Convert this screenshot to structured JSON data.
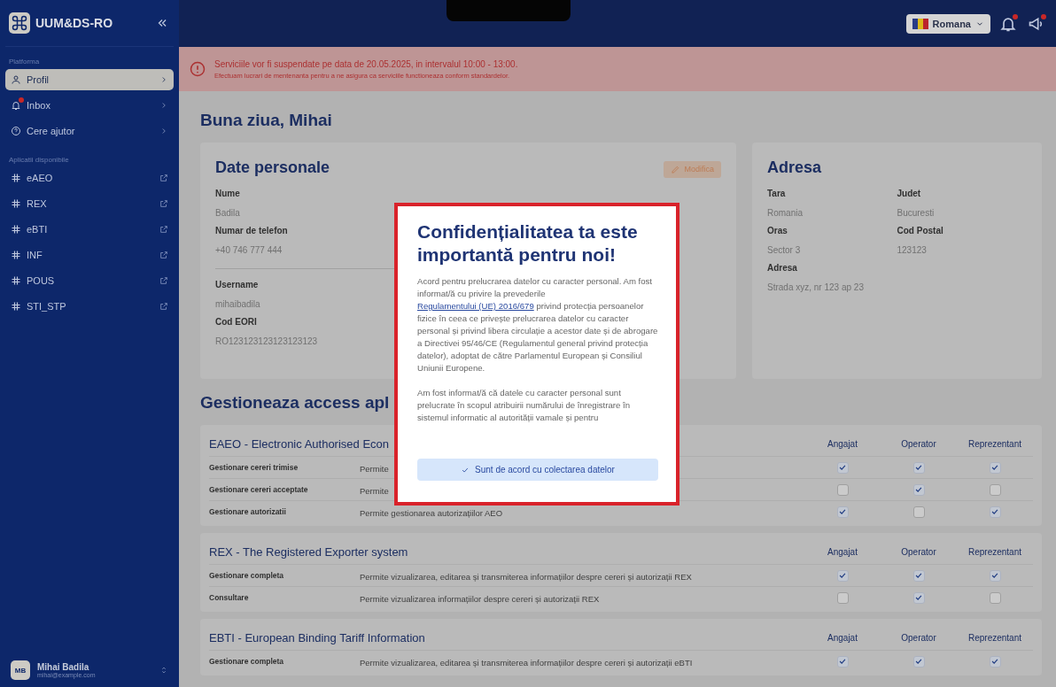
{
  "sidebar": {
    "logo_text": "UUM&DS-RO",
    "sections": [
      {
        "heading": "Platforma",
        "kind": "platform",
        "items": [
          {
            "label": "Profil",
            "selected": true,
            "badge": false
          },
          {
            "label": "Inbox",
            "selected": false,
            "badge": true
          },
          {
            "label": "Cere ajutor",
            "selected": false,
            "badge": false
          }
        ]
      },
      {
        "heading": "Aplicatii disponibile",
        "kind": "apps",
        "items": [
          {
            "label": "eAEO",
            "selected": false,
            "badge": false
          },
          {
            "label": "REX",
            "selected": false,
            "badge": false
          },
          {
            "label": "eBTI",
            "selected": false,
            "badge": false
          },
          {
            "label": "INF",
            "selected": false,
            "badge": false
          },
          {
            "label": "POUS",
            "selected": false,
            "badge": false
          },
          {
            "label": "STI_STP",
            "selected": false,
            "badge": false
          }
        ]
      }
    ],
    "user": {
      "initials": "MB",
      "name": "Mihai Badila",
      "email": "mihai@example.com"
    }
  },
  "header": {
    "language": "Romana",
    "bell_badge": true,
    "megaphone_badge": true
  },
  "alert": {
    "title": "Serviciile vor fi suspendate pe data de 20.05.2025, in intervalul 10:00 - 13:00.",
    "message": "Efectuam lucrari de mentenanta pentru a ne asigura ca serviciile functioneaza conform standardelor."
  },
  "greeting": "Buna ziua, Mihai",
  "personal": {
    "title": "Date personale",
    "edit_button": "Modifica",
    "groups": [
      [
        {
          "label": "Nume",
          "value": "Badila"
        },
        {
          "label": "Numar de telefon",
          "value": "+40 746 777 444"
        }
      ],
      [
        {
          "label": "Username",
          "value": "mihaibadila"
        },
        {
          "label": "Cod EORI",
          "value": "RO123123123123123123"
        }
      ]
    ]
  },
  "address": {
    "title": "Adresa",
    "fields": [
      {
        "label": "Tara",
        "value": "Romania"
      },
      {
        "label": "Judet",
        "value": "Bucuresti"
      },
      {
        "label": "Oras",
        "value": "Sector 3"
      },
      {
        "label": "Cod Postal",
        "value": "123123"
      },
      {
        "label": "Adresa",
        "value": "Strada xyz, nr 123 ap 23"
      }
    ]
  },
  "access": {
    "title": "Gestioneaza access apl",
    "groups": [
      {
        "title": "EAEO - Electronic Authorised Econ",
        "columns": [
          "Angajat",
          "Operator",
          "Reprezentant"
        ],
        "rows": [
          {
            "name": "Gestionare cereri trimise",
            "description": "Permite",
            "checks": [
              {
                "checked": true
              },
              {
                "checked": true
              },
              {
                "checked": true
              }
            ]
          },
          {
            "name": "Gestionare cereri acceptate",
            "description": "Permite",
            "checks": [
              {
                "checked": false
              },
              {
                "checked": true
              },
              {
                "checked": false
              }
            ]
          },
          {
            "name": "Gestionare autorizatii",
            "description": "Permite gestionarea autorizațiilor AEO",
            "checks": [
              {
                "checked": true
              },
              {
                "checked": false
              },
              {
                "checked": true
              }
            ]
          }
        ]
      },
      {
        "title": "REX - The Registered Exporter system",
        "columns": [
          "Angajat",
          "Operator",
          "Reprezentant"
        ],
        "rows": [
          {
            "name": "Gestionare completa",
            "description": "Permite vizualizarea, editarea și transmiterea informațiilor despre cereri și autorizații REX",
            "checks": [
              {
                "checked": true
              },
              {
                "checked": true
              },
              {
                "checked": true
              }
            ]
          },
          {
            "name": "Consultare",
            "description": "Permite vizualizarea informațiilor despre cereri și autorizații REX",
            "checks": [
              {
                "checked": false
              },
              {
                "checked": true
              },
              {
                "checked": false
              }
            ]
          }
        ]
      },
      {
        "title": "EBTI - European Binding Tariff Information",
        "columns": [
          "Angajat",
          "Operator",
          "Reprezentant"
        ],
        "rows": [
          {
            "name": "Gestionare completa",
            "description": "Permite vizualizarea, editarea și transmiterea informațiilor despre cereri și autorizații eBTI",
            "checks": [
              {
                "checked": true
              },
              {
                "checked": true
              },
              {
                "checked": true
              }
            ]
          }
        ]
      }
    ]
  },
  "modal": {
    "title": "Confidențialitatea ta este importantă pentru noi!",
    "intro": "Acord pentru prelucrarea datelor cu caracter personal. Am fost informat/ă cu privire la prevederile",
    "link": "Regulamentului (UE) 2016/679",
    "after_link": "privind protecția persoanelor fizice în ceea ce privește prelucrarea datelor cu caracter personal și privind libera circulație a acestor date și de abrogare a Directivei 95/46/CE (Regulamentul general privind protecția datelor), adoptat de către Parlamentul European și Consiliul Uniunii Europene.",
    "paragraph_2": "Am fost informat/ă că datele cu caracter personal sunt prelucrate în scopul atribuirii numărului de înregistrare în sistemul informatic al autorității vamale și pentru",
    "button": "Sunt de acord cu colectarea datelor"
  }
}
